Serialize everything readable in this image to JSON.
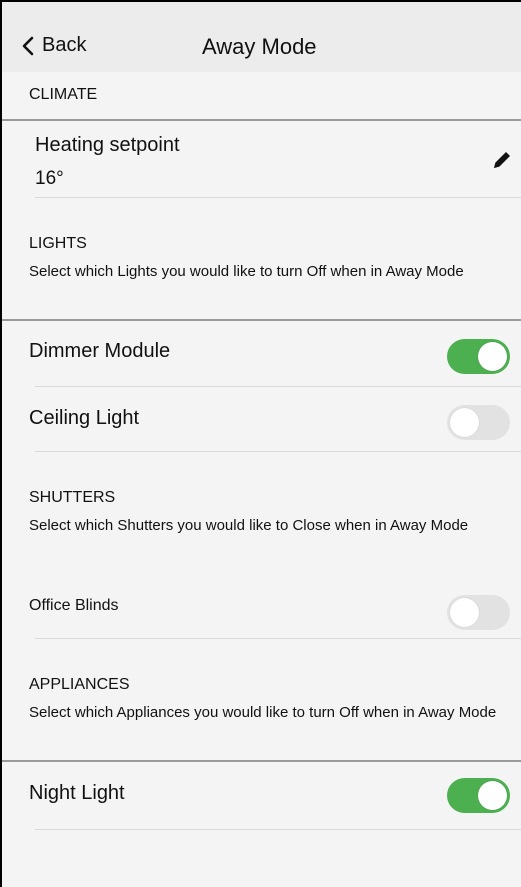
{
  "header": {
    "back_label": "Back",
    "title": "Away Mode"
  },
  "climate": {
    "section_title": "CLIMATE",
    "setpoint_label": "Heating setpoint",
    "setpoint_value": "16°"
  },
  "lights": {
    "section_title": "LIGHTS",
    "description": "Select which Lights you would like to turn Off when in Away Mode",
    "items": [
      {
        "label": "Dimmer Module",
        "on": true
      },
      {
        "label": "Ceiling Light",
        "on": false
      }
    ]
  },
  "shutters": {
    "section_title": "SHUTTERS",
    "description": "Select which Shutters you would like to Close when in Away Mode",
    "items": [
      {
        "label": "Office Blinds",
        "on": false
      }
    ]
  },
  "appliances": {
    "section_title": "APPLIANCES",
    "description": "Select which Appliances you would like to turn Off when in Away Mode",
    "items": [
      {
        "label": "Night Light",
        "on": true
      }
    ]
  },
  "colors": {
    "toggle_on": "#4caf50",
    "toggle_off": "#e2e2e2",
    "header_bg": "#ececec"
  },
  "icons": {
    "back": "chevron-left-icon",
    "edit": "pencil-icon"
  }
}
